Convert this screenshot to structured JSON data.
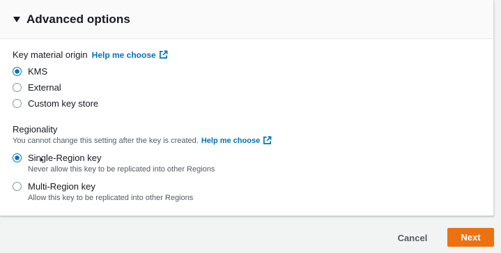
{
  "panel": {
    "title": "Advanced options"
  },
  "key_material": {
    "label": "Key material origin",
    "help_link": "Help me choose",
    "options": [
      {
        "label": "KMS",
        "checked": true
      },
      {
        "label": "External",
        "checked": false
      },
      {
        "label": "Custom key store",
        "checked": false
      }
    ]
  },
  "regionality": {
    "label": "Regionality",
    "note": "You cannot change this setting after the key is created.",
    "help_link": "Help me choose",
    "options": [
      {
        "label": "Single-Region key",
        "description": "Never allow this key to be replicated into other Regions",
        "checked": true
      },
      {
        "label": "Multi-Region key",
        "description": "Allow this key to be replicated into other Regions",
        "checked": false
      }
    ]
  },
  "footer": {
    "cancel_label": "Cancel",
    "next_label": "Next"
  },
  "colors": {
    "accent": "#0073bb",
    "primary_button": "#ec7211"
  },
  "icons": {
    "expand": "caret-down-icon",
    "external": "external-link-icon",
    "cursor": "mouse-cursor-icon"
  }
}
